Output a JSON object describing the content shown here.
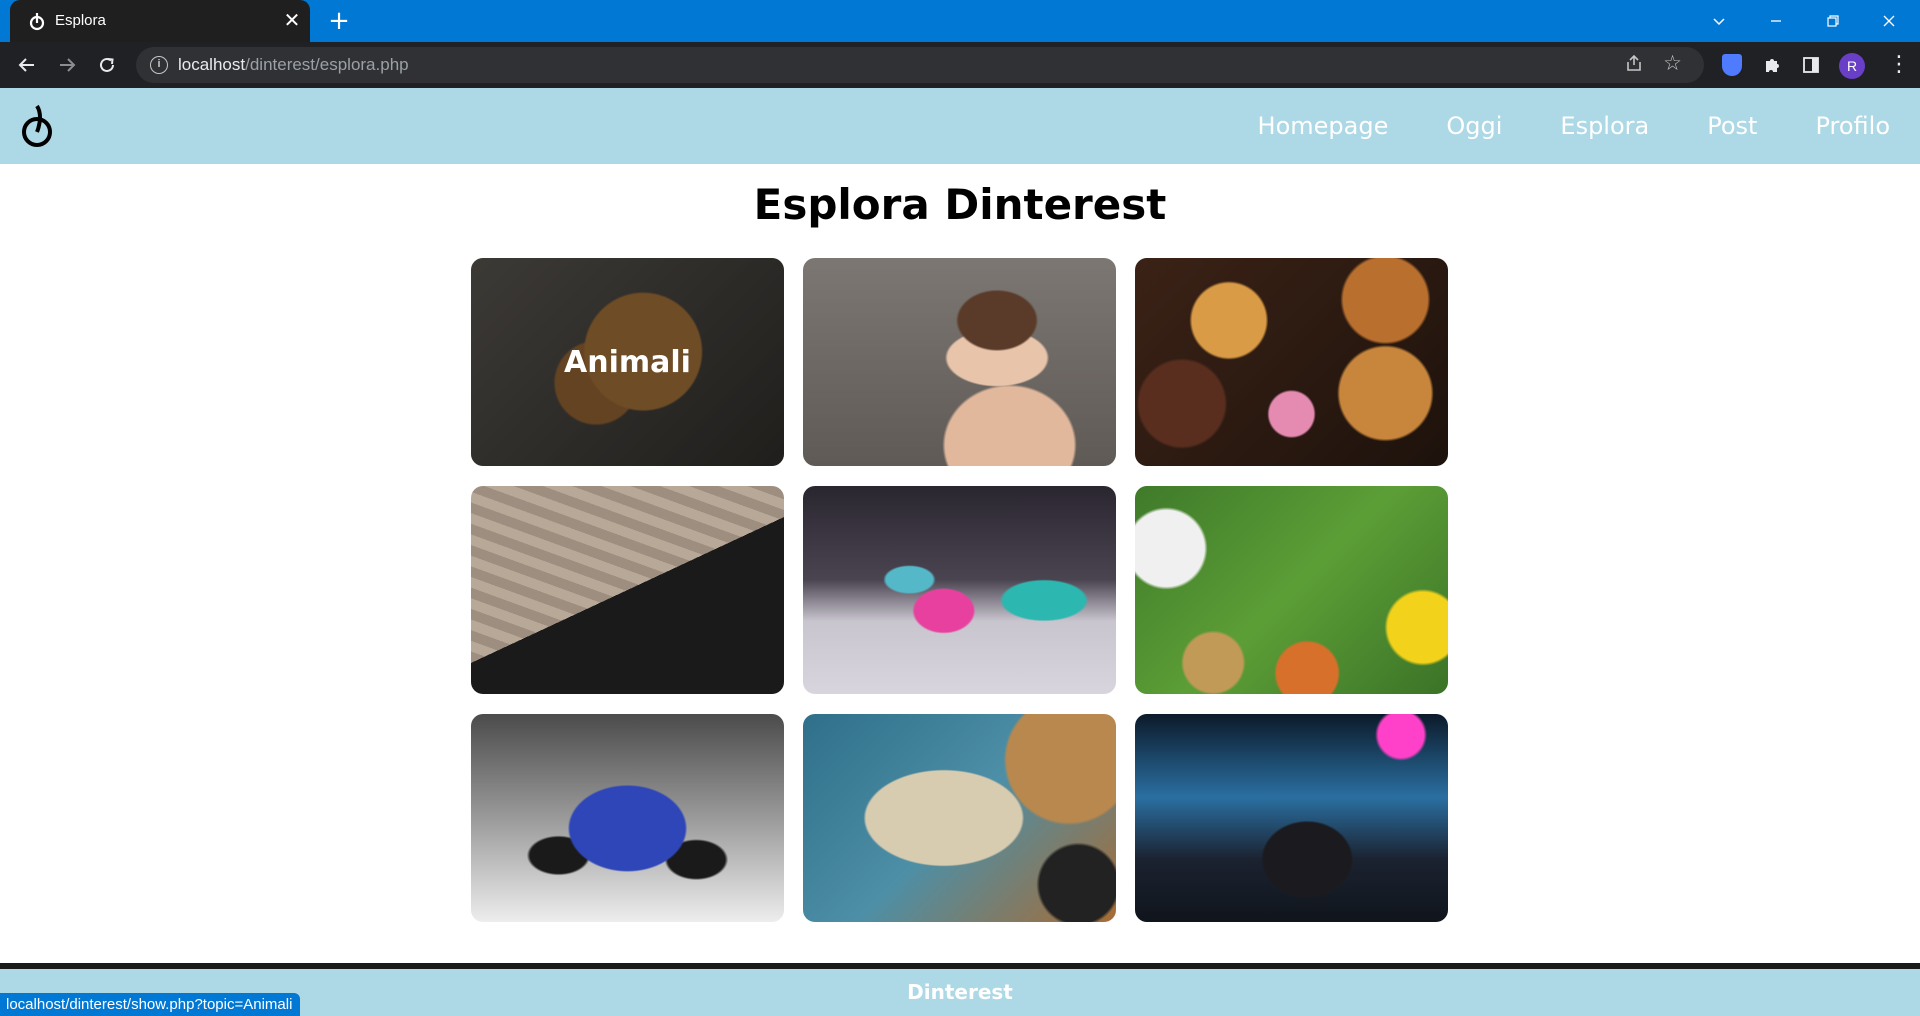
{
  "browser": {
    "tab_title": "Esplora",
    "tab_close": "✕",
    "new_tab": "+",
    "url_host": "localhost",
    "url_path": "/dinterest/esplora.php",
    "avatar_initial": "R",
    "status_url": "localhost/dinterest/show.php?topic=Animali"
  },
  "site": {
    "nav": [
      "Homepage",
      "Oggi",
      "Esplora",
      "Post",
      "Profilo"
    ],
    "page_title": "Esplora Dinterest",
    "footer": "Dinterest"
  },
  "grid": {
    "hovered_label": "Animali"
  },
  "colors": {
    "tab_bar": "#0078d4",
    "site_nav": "#add8e6",
    "footer": "#add8e6"
  }
}
